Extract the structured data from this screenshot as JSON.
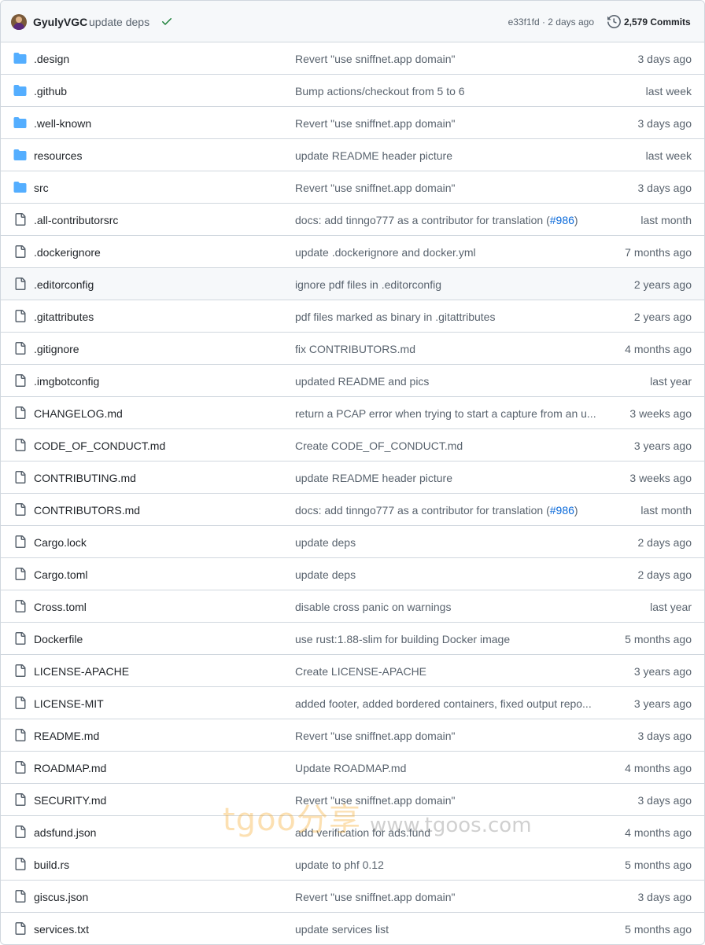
{
  "latest_commit": {
    "author": "GyulyVGC",
    "message": "update deps",
    "status_icon": "check-icon",
    "sha_and_time": "e33f1fd · 2 days ago",
    "commits_count": "2,579 Commits"
  },
  "colors": {
    "folder": "#54aeff",
    "link": "#0969da",
    "check": "#1a7f37",
    "muted": "#59636e"
  },
  "files": [
    {
      "type": "folder",
      "name": ".design",
      "commit": "Revert \"use sniffnet.app domain\"",
      "pr": "",
      "commit_end": "",
      "age": "3 days ago"
    },
    {
      "type": "folder",
      "name": ".github",
      "commit": "Bump actions/checkout from 5 to 6",
      "pr": "",
      "commit_end": "",
      "age": "last week"
    },
    {
      "type": "folder",
      "name": ".well-known",
      "commit": "Revert \"use sniffnet.app domain\"",
      "pr": "",
      "commit_end": "",
      "age": "3 days ago"
    },
    {
      "type": "folder",
      "name": "resources",
      "commit": "update README header picture",
      "pr": "",
      "commit_end": "",
      "age": "last week"
    },
    {
      "type": "folder",
      "name": "src",
      "commit": "Revert \"use sniffnet.app domain\"",
      "pr": "",
      "commit_end": "",
      "age": "3 days ago"
    },
    {
      "type": "file",
      "name": ".all-contributorsrc",
      "commit": "docs: add tinngo777 as a contributor for translation (",
      "pr": "#986",
      "commit_end": ")",
      "age": "last month"
    },
    {
      "type": "file",
      "name": ".dockerignore",
      "commit": "update .dockerignore and docker.yml",
      "pr": "",
      "commit_end": "",
      "age": "7 months ago"
    },
    {
      "type": "file",
      "name": ".editorconfig",
      "commit": "ignore pdf files in .editorconfig",
      "pr": "",
      "commit_end": "",
      "age": "2 years ago"
    },
    {
      "type": "file",
      "name": ".gitattributes",
      "commit": "pdf files marked as binary in .gitattributes",
      "pr": "",
      "commit_end": "",
      "age": "2 years ago"
    },
    {
      "type": "file",
      "name": ".gitignore",
      "commit": "fix CONTRIBUTORS.md",
      "pr": "",
      "commit_end": "",
      "age": "4 months ago"
    },
    {
      "type": "file",
      "name": ".imgbotconfig",
      "commit": "updated README and pics",
      "pr": "",
      "commit_end": "",
      "age": "last year"
    },
    {
      "type": "file",
      "name": "CHANGELOG.md",
      "commit": "return a PCAP error when trying to start a capture from an u...",
      "pr": "",
      "commit_end": "",
      "age": "3 weeks ago"
    },
    {
      "type": "file",
      "name": "CODE_OF_CONDUCT.md",
      "commit": "Create CODE_OF_CONDUCT.md",
      "pr": "",
      "commit_end": "",
      "age": "3 years ago"
    },
    {
      "type": "file",
      "name": "CONTRIBUTING.md",
      "commit": "update README header picture",
      "pr": "",
      "commit_end": "",
      "age": "3 weeks ago"
    },
    {
      "type": "file",
      "name": "CONTRIBUTORS.md",
      "commit": "docs: add tinngo777 as a contributor for translation (",
      "pr": "#986",
      "commit_end": ")",
      "age": "last month"
    },
    {
      "type": "file",
      "name": "Cargo.lock",
      "commit": "update deps",
      "pr": "",
      "commit_end": "",
      "age": "2 days ago"
    },
    {
      "type": "file",
      "name": "Cargo.toml",
      "commit": "update deps",
      "pr": "",
      "commit_end": "",
      "age": "2 days ago"
    },
    {
      "type": "file",
      "name": "Cross.toml",
      "commit": "disable cross panic on warnings",
      "pr": "",
      "commit_end": "",
      "age": "last year"
    },
    {
      "type": "file",
      "name": "Dockerfile",
      "commit": "use rust:1.88-slim for building Docker image",
      "pr": "",
      "commit_end": "",
      "age": "5 months ago"
    },
    {
      "type": "file",
      "name": "LICENSE-APACHE",
      "commit": "Create LICENSE-APACHE",
      "pr": "",
      "commit_end": "",
      "age": "3 years ago"
    },
    {
      "type": "file",
      "name": "LICENSE-MIT",
      "commit": "added footer, added bordered containers, fixed output repo...",
      "pr": "",
      "commit_end": "",
      "age": "3 years ago"
    },
    {
      "type": "file",
      "name": "README.md",
      "commit": "Revert \"use sniffnet.app domain\"",
      "pr": "",
      "commit_end": "",
      "age": "3 days ago"
    },
    {
      "type": "file",
      "name": "ROADMAP.md",
      "commit": "Update ROADMAP.md",
      "pr": "",
      "commit_end": "",
      "age": "4 months ago"
    },
    {
      "type": "file",
      "name": "SECURITY.md",
      "commit": "Revert \"use sniffnet.app domain\"",
      "pr": "",
      "commit_end": "",
      "age": "3 days ago"
    },
    {
      "type": "file",
      "name": "adsfund.json",
      "commit": "add verification for ads.fund",
      "pr": "",
      "commit_end": "",
      "age": "4 months ago"
    },
    {
      "type": "file",
      "name": "build.rs",
      "commit": "update to phf 0.12",
      "pr": "",
      "commit_end": "",
      "age": "5 months ago"
    },
    {
      "type": "file",
      "name": "giscus.json",
      "commit": "Revert \"use sniffnet.app domain\"",
      "pr": "",
      "commit_end": "",
      "age": "3 days ago"
    },
    {
      "type": "file",
      "name": "services.txt",
      "commit": "update services list",
      "pr": "",
      "commit_end": "",
      "age": "5 months ago"
    }
  ],
  "watermark": {
    "brand": "tgoo分享",
    "url": "www.tgoos.com"
  }
}
